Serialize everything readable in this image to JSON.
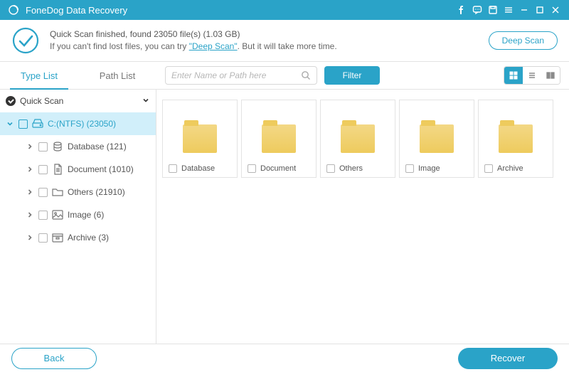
{
  "app": {
    "title": "FoneDog Data Recovery"
  },
  "banner": {
    "line1": "Quick Scan finished, found 23050 file(s) (1.03 GB)",
    "line2_pre": "If you can't find lost files, you can try ",
    "line2_link": "\"Deep Scan\"",
    "line2_post": ". But it will take more time.",
    "deep_scan": "Deep Scan"
  },
  "tabs": {
    "type_list": "Type List",
    "path_list": "Path List"
  },
  "search": {
    "placeholder": "Enter Name or Path here"
  },
  "filter_label": "Filter",
  "tree": {
    "root": "Quick Scan",
    "drive": "C:(NTFS) (23050)",
    "items": [
      {
        "label": "Database (121)",
        "icon": "database"
      },
      {
        "label": "Document (1010)",
        "icon": "document"
      },
      {
        "label": "Others (21910)",
        "icon": "folder"
      },
      {
        "label": "Image (6)",
        "icon": "image"
      },
      {
        "label": "Archive (3)",
        "icon": "archive"
      }
    ]
  },
  "folders": [
    {
      "label": "Database"
    },
    {
      "label": "Document"
    },
    {
      "label": "Others"
    },
    {
      "label": "Image"
    },
    {
      "label": "Archive"
    }
  ],
  "footer": {
    "back": "Back",
    "recover": "Recover"
  }
}
